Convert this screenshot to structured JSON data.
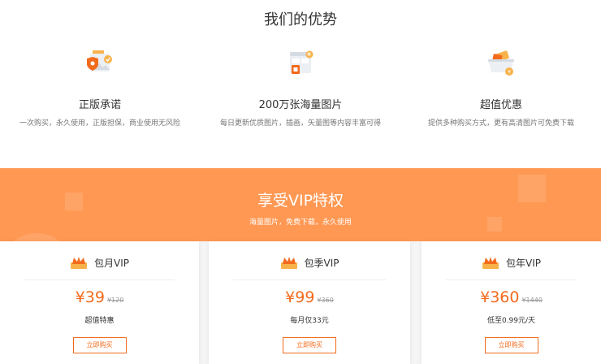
{
  "advantages": {
    "title": "我们的优势",
    "items": [
      {
        "name": "正版承诺",
        "desc": "一次购买，永久使用，正版担保，商业使用无风险",
        "icon": "shield-image-icon"
      },
      {
        "name": "200万张海量图片",
        "desc": "每日更新优质图片，插画，矢量图等内容丰富可得",
        "icon": "gallery-icon"
      },
      {
        "name": "超值优惠",
        "desc": "提供多种购买方式，更有高清图片可免费下载",
        "icon": "discount-basket-icon"
      }
    ]
  },
  "vip": {
    "title": "享受VIP特权",
    "subtitle": "海量图片，免费下载，永久使用",
    "plans": [
      {
        "name": "包月VIP",
        "currency": "¥",
        "price": "39",
        "original": "¥120",
        "note": "超值特惠",
        "button": "立即购买"
      },
      {
        "name": "包季VIP",
        "currency": "¥",
        "price": "99",
        "original": "¥360",
        "note": "每月仅33元",
        "button": "立即购买"
      },
      {
        "name": "包年VIP",
        "currency": "¥",
        "price": "360",
        "original": "¥1440",
        "note": "低至0.99元/天",
        "button": "立即购买"
      }
    ]
  },
  "colors": {
    "accent": "#f26b1d",
    "band": "#ff9853",
    "icon_gold": "#f8b24a"
  }
}
